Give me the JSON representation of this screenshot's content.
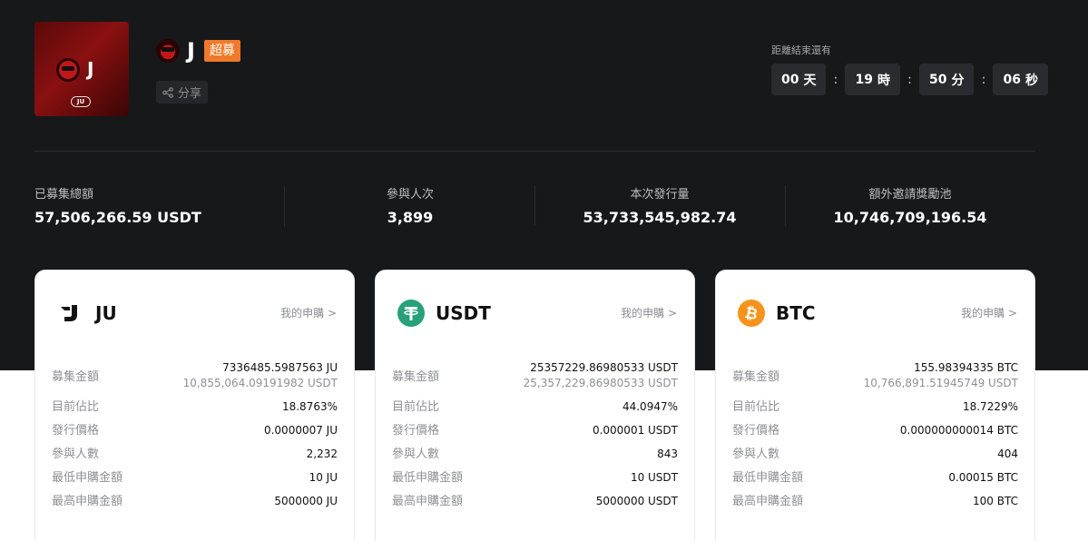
{
  "project": {
    "logo_letter": "J",
    "logo_tag": "JU",
    "title": "J",
    "badge": "超募",
    "share_label": "分享"
  },
  "countdown": {
    "label": "距離結束還有",
    "days": "00",
    "days_unit": "天",
    "hours": "19",
    "hours_unit": "時",
    "minutes": "50",
    "minutes_unit": "分",
    "seconds": "06",
    "seconds_unit": "秒",
    "separator": ":"
  },
  "stats": [
    {
      "label": "已募集總額",
      "value": "57,506,266.59 USDT"
    },
    {
      "label": "參與人次",
      "value": "3,899"
    },
    {
      "label": "本次發行量",
      "value": "53,733,545,982.74"
    },
    {
      "label": "額外邀請獎勵池",
      "value": "10,746,709,196.54"
    }
  ],
  "cards": [
    {
      "coin": "JU",
      "link": "我的申購 >",
      "raised_label": "募集金額",
      "raised": "7336485.5987563 JU",
      "raised_usdt": "10,855,064.09191982 USDT",
      "ratio_label": "目前佔比",
      "ratio": "18.8763%",
      "price_label": "發行價格",
      "price": "0.0000007 JU",
      "participants_label": "參與人數",
      "participants": "2,232",
      "min_label": "最低申購金額",
      "min": "10 JU",
      "max_label": "最高申購金額",
      "max": "5000000 JU"
    },
    {
      "coin": "USDT",
      "link": "我的申購 >",
      "raised_label": "募集金額",
      "raised": "25357229.86980533 USDT",
      "raised_usdt": "25,357,229.86980533 USDT",
      "ratio_label": "目前佔比",
      "ratio": "44.0947%",
      "price_label": "發行價格",
      "price": "0.000001 USDT",
      "participants_label": "參與人數",
      "participants": "843",
      "min_label": "最低申購金額",
      "min": "10 USDT",
      "max_label": "最高申購金額",
      "max": "5000000 USDT"
    },
    {
      "coin": "BTC",
      "link": "我的申購 >",
      "raised_label": "募集金額",
      "raised": "155.98394335 BTC",
      "raised_usdt": "10,766,891.51945749 USDT",
      "ratio_label": "目前佔比",
      "ratio": "18.7229%",
      "price_label": "發行價格",
      "price": "0.000000000014 BTC",
      "participants_label": "參與人數",
      "participants": "404",
      "min_label": "最低申購金額",
      "min": "0.00015 BTC",
      "max_label": "最高申購金額",
      "max": "100 BTC"
    }
  ],
  "colors": {
    "dark_bg": "#17181a",
    "badge": "#f07a2a",
    "usdt": "#26a17b",
    "btc": "#f7931a"
  },
  "icons": {
    "share": "share-icon",
    "ju": "ju-logo-icon",
    "usdt": "usdt-icon",
    "btc": "btc-icon"
  }
}
